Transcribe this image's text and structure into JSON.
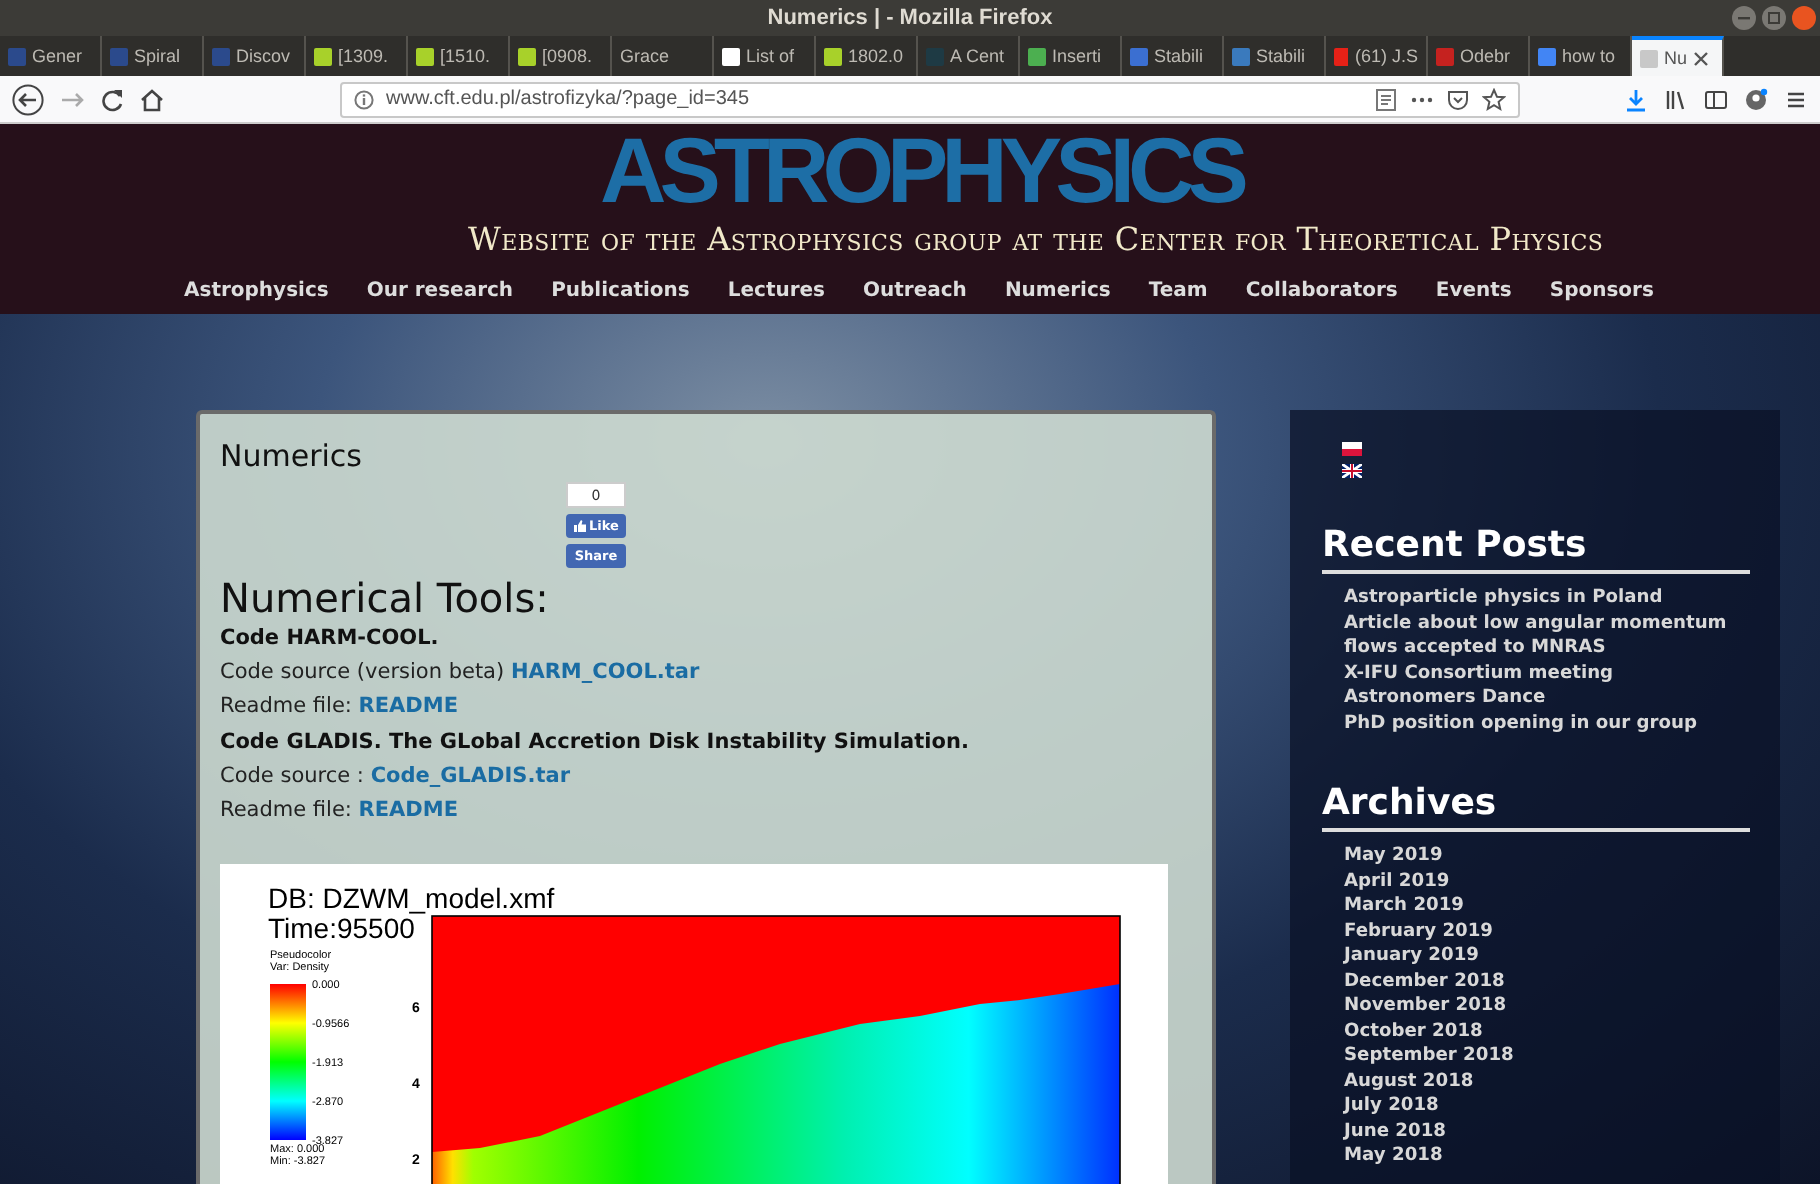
{
  "window": {
    "title": "Numerics | - Mozilla Firefox"
  },
  "tabs": [
    {
      "label": "Gener",
      "selected": false,
      "color": "#2b4a8c"
    },
    {
      "label": "Spiral",
      "selected": false,
      "color": "#2b4a8c"
    },
    {
      "label": "Discov",
      "selected": false,
      "color": "#2b4a8c"
    },
    {
      "label": "[1309.",
      "selected": false,
      "color": "#a8d12a"
    },
    {
      "label": "[1510.",
      "selected": false,
      "color": "#a8d12a"
    },
    {
      "label": "[0908.",
      "selected": false,
      "color": "#a8d12a"
    },
    {
      "label": "Grace",
      "selected": false
    },
    {
      "label": "List of",
      "selected": false,
      "color": "#ffffff"
    },
    {
      "label": "1802.0",
      "selected": false,
      "color": "#a8d12a"
    },
    {
      "label": "A Cent",
      "selected": false,
      "color": "#1e3a44"
    },
    {
      "label": "Inserti",
      "selected": false,
      "color": "#4caf50"
    },
    {
      "label": "Stabili",
      "selected": false,
      "color": "#3b6fd1"
    },
    {
      "label": "Stabili",
      "selected": false,
      "color": "#3a7abd"
    },
    {
      "label": "(61) J.S",
      "selected": false,
      "color": "#e62117"
    },
    {
      "label": "Odebr",
      "selected": false,
      "color": "#c5221f"
    },
    {
      "label": "how to",
      "selected": false,
      "color": "#4285f4"
    },
    {
      "label": "Nu",
      "selected": true,
      "color": "#c8c8c8"
    }
  ],
  "address_bar": {
    "url": "www.cft.edu.pl/astrofizyka/?page_id=345"
  },
  "site": {
    "title": "ASTROPHYSICS",
    "subtitle": "Website of the Astrophysics group at the Center for Theoretical Physics",
    "nav": [
      "Astrophysics",
      "Our research",
      "Publications",
      "Lectures",
      "Outreach",
      "Numerics",
      "Team",
      "Collaborators",
      "Events",
      "Sponsors"
    ]
  },
  "article": {
    "title": "Numerics",
    "like_widget": {
      "count": "0",
      "like": "Like",
      "share": "Share"
    },
    "heading": "Numerical Tools:",
    "lines": [
      {
        "kind": "bold",
        "text": "Code HARM-COOL."
      },
      {
        "kind": "link_line",
        "text": "Code source (version beta)",
        "link": "HARM_COOL.tar"
      },
      {
        "kind": "link_line",
        "text": "Readme file:",
        "link": "README"
      },
      {
        "kind": "bold",
        "text": "Code GLADIS. The GLobal Accretion Disk Instability Simulation."
      },
      {
        "kind": "link_line",
        "text": "Code source :",
        "link": "Code_GLADIS.tar"
      },
      {
        "kind": "link_line",
        "text": "Readme file:",
        "link": "README"
      }
    ],
    "figure": {
      "db": "DB: DZWM_model.xmf",
      "time": "Time:95500",
      "legend_title": "Pseudocolor",
      "legend_var": "Var: Density",
      "legend_ticks": [
        "0.000",
        "-0.9566",
        "-1.913",
        "-2.870",
        "-3.827"
      ],
      "max": "Max: 0.000",
      "min": "Min: -3.827",
      "y_ticks": [
        "6",
        "4",
        "2"
      ]
    }
  },
  "sidebar": {
    "recent_posts": {
      "title": "Recent Posts",
      "items": [
        "Astroparticle physics in Poland",
        "Article about low angular momentum flows accepted to MNRAS",
        "X-IFU Consortium meeting",
        "Astronomers Dance",
        "PhD position opening in our group"
      ]
    },
    "archives": {
      "title": "Archives",
      "items": [
        "May 2019",
        "April 2019",
        "March 2019",
        "February 2019",
        "January 2019",
        "December 2018",
        "November 2018",
        "October 2018",
        "September 2018",
        "August 2018",
        "July 2018",
        "June 2018",
        "May 2018"
      ]
    }
  }
}
